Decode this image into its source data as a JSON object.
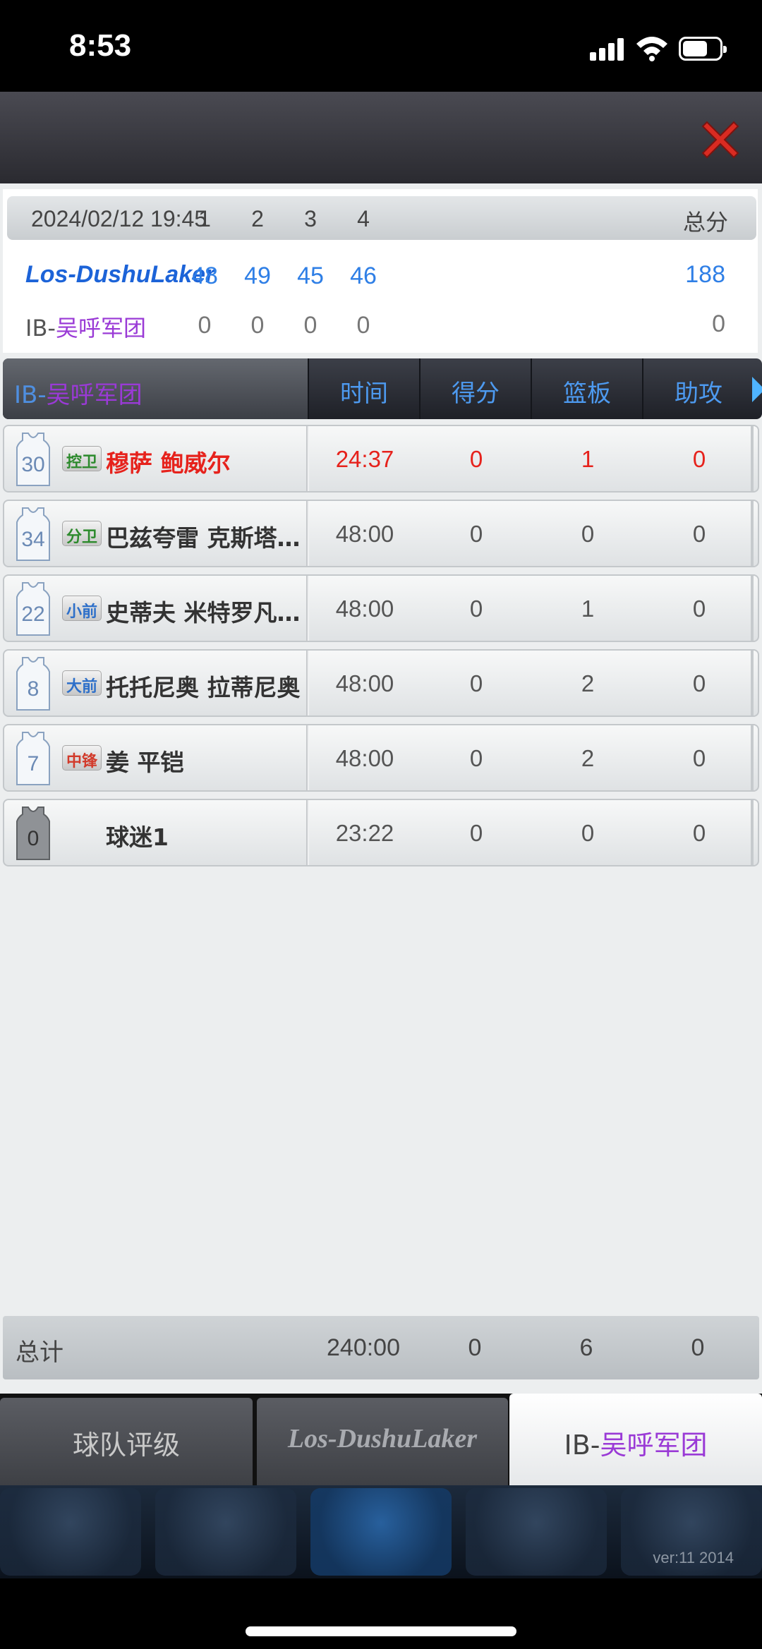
{
  "status_bar": {
    "time": "8:53"
  },
  "scoreboard": {
    "date": "2024/02/12 19:45",
    "quarters": [
      "1",
      "2",
      "3",
      "4"
    ],
    "total_label": "总分",
    "team_a": {
      "name": "Los-DushuLaker",
      "q": [
        "48",
        "49",
        "45",
        "46"
      ],
      "total": "188"
    },
    "team_b": {
      "prefix": "IB-",
      "name": "吴呼军团",
      "q": [
        "0",
        "0",
        "0",
        "0"
      ],
      "total": "0"
    }
  },
  "table": {
    "team_prefix": "IB-",
    "team_name": "吴呼军团",
    "columns": [
      "时间",
      "得分",
      "篮板",
      "助攻"
    ],
    "rows": [
      {
        "number": "30",
        "position": "控卫",
        "name": "穆萨 鲍威尔",
        "time": "24:37",
        "points": "0",
        "rebounds": "1",
        "assists": "0"
      },
      {
        "number": "34",
        "position": "分卫",
        "name": "巴兹夸雷 克斯塔...",
        "time": "48:00",
        "points": "0",
        "rebounds": "0",
        "assists": "0"
      },
      {
        "number": "22",
        "position": "小前",
        "name": "史蒂夫 米特罗凡...",
        "time": "48:00",
        "points": "0",
        "rebounds": "1",
        "assists": "0"
      },
      {
        "number": "8",
        "position": "大前",
        "name": "托托尼奥 拉蒂尼奥",
        "time": "48:00",
        "points": "0",
        "rebounds": "2",
        "assists": "0"
      },
      {
        "number": "7",
        "position": "中锋",
        "name": "姜 平铠",
        "time": "48:00",
        "points": "0",
        "rebounds": "2",
        "assists": "0"
      },
      {
        "number": "0",
        "position": "",
        "name": "球迷1",
        "time": "23:22",
        "points": "0",
        "rebounds": "0",
        "assists": "0"
      }
    ],
    "total": {
      "label": "总计",
      "time": "240:00",
      "points": "0",
      "rebounds": "6",
      "assists": "0"
    }
  },
  "tabs": {
    "rating": "球队评级",
    "team_a": "Los-DushuLaker",
    "team_b_prefix": "IB-",
    "team_b_name": "吴呼军团"
  },
  "footer": {
    "version": "ver:11  2014"
  },
  "colors": {
    "accent_blue": "#2f7fe6",
    "highlight_red": "#e6221c",
    "team_purple": "#9a3ad6"
  }
}
